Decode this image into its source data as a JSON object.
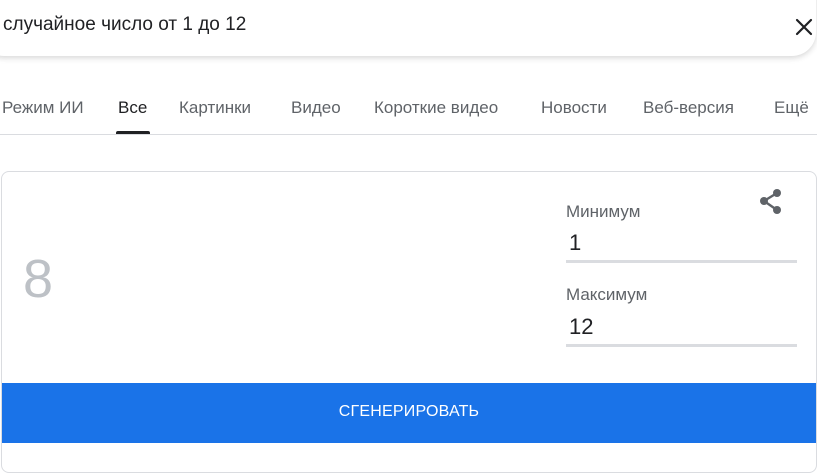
{
  "search": {
    "query": "случайное число от 1 до 12",
    "clear_icon": "close-icon"
  },
  "tabs": [
    {
      "label": "Режим ИИ",
      "active": false
    },
    {
      "label": "Все",
      "active": true
    },
    {
      "label": "Картинки",
      "active": false
    },
    {
      "label": "Видео",
      "active": false
    },
    {
      "label": "Короткие видео",
      "active": false
    },
    {
      "label": "Новости",
      "active": false
    },
    {
      "label": "Веб-версия",
      "active": false
    },
    {
      "label": "Ещё",
      "active": false
    }
  ],
  "generator": {
    "result": "8",
    "share_icon": "share-icon",
    "min_label": "Минимум",
    "min_value": "1",
    "max_label": "Максимум",
    "max_value": "12",
    "generate_label": "СГЕНЕРИРОВАТЬ"
  },
  "colors": {
    "accent": "#1a73e8",
    "result_text": "#bdc1c6",
    "secondary_text": "#5f6368"
  }
}
